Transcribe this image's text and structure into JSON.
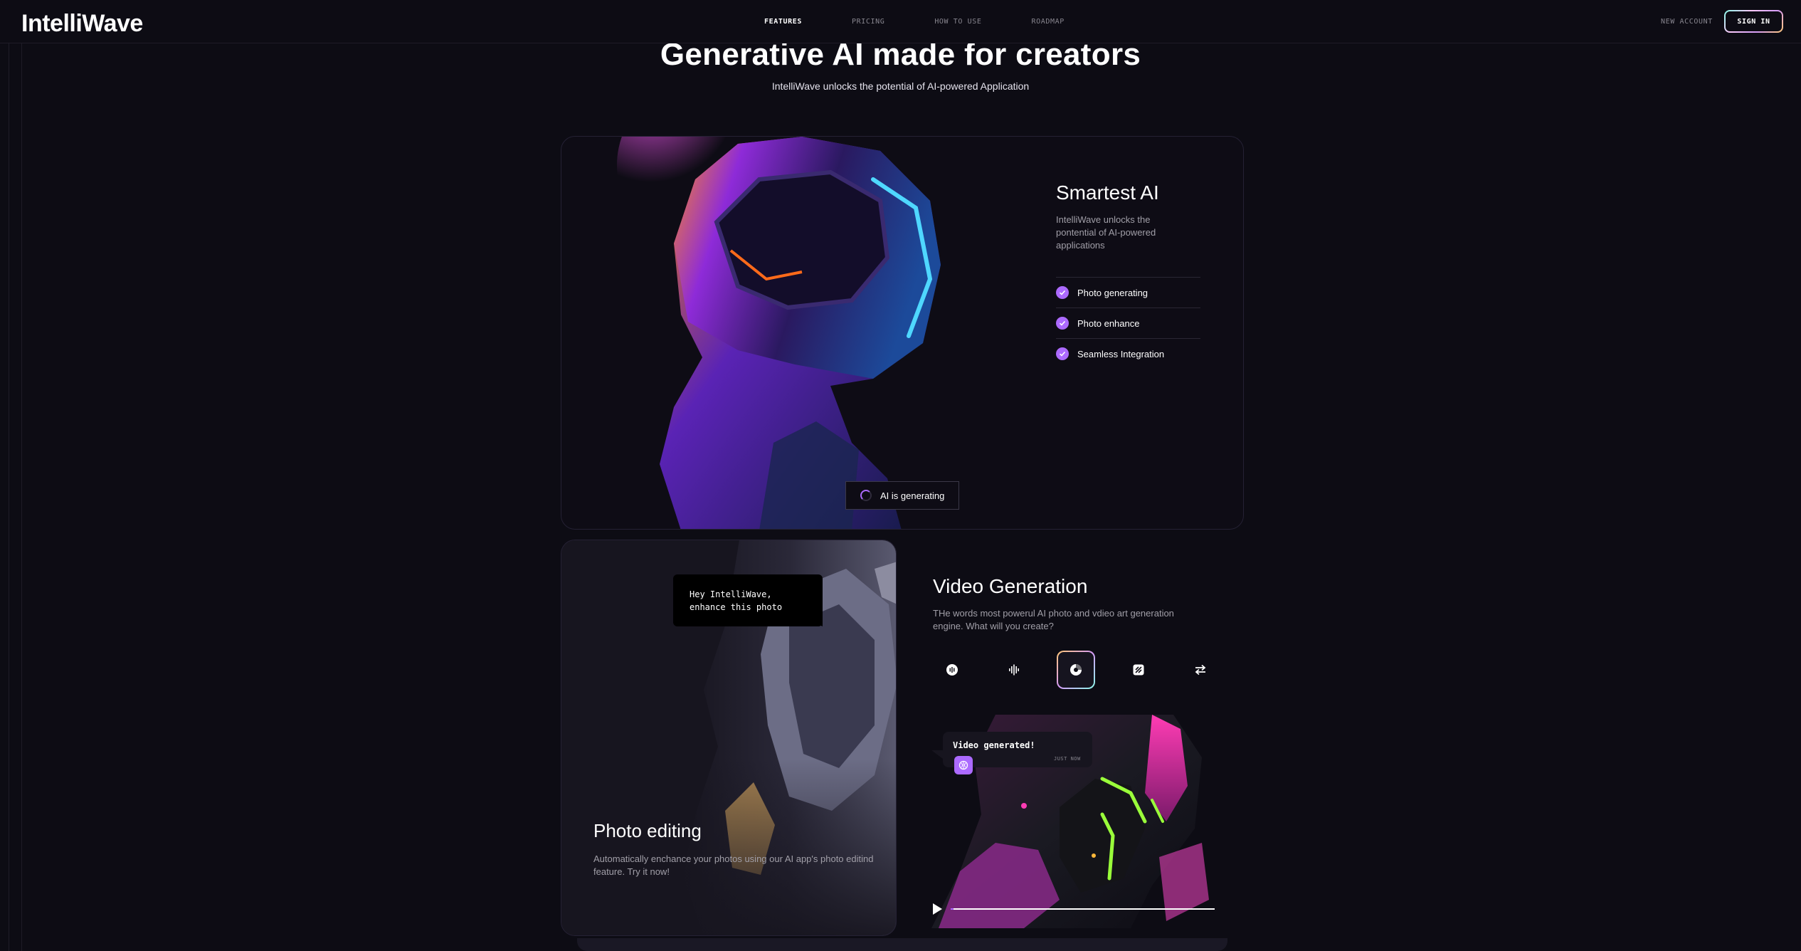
{
  "header": {
    "logo": "IntelliWave",
    "nav": [
      {
        "label": "FEATURES",
        "active": true
      },
      {
        "label": "PRICING",
        "active": false
      },
      {
        "label": "HOW TO USE",
        "active": false
      },
      {
        "label": "ROADMAP",
        "active": false
      }
    ],
    "new_account": "NEW ACCOUNT",
    "sign_in": "SIGN IN"
  },
  "hero": {
    "title": "Generative AI made for creators",
    "subtitle": "IntelliWave unlocks the potential of AI-powered Application"
  },
  "smartest": {
    "title": "Smartest AI",
    "description": "IntelliWave unlocks the pontential of AI-powered applications",
    "features": [
      "Photo generating",
      "Photo enhance",
      "Seamless Integration"
    ],
    "status": "AI is generating"
  },
  "photo_editing": {
    "prompt": "Hey IntelliWave, enhance this photo",
    "title": "Photo editing",
    "description": "Automatically enchance your photos using our AI app's photo editind feature. Try it now!"
  },
  "video": {
    "title": "Video Generation",
    "description": "THe words most powerul AI photo and vdieo art generation engine. What will you create?",
    "tools": [
      "recording-icon",
      "waveform-icon",
      "disc-icon",
      "media-icon",
      "swap-icon"
    ],
    "active_tool": 2,
    "message": "Video generated!",
    "message_time": "JUST NOW",
    "progress": 0.01
  },
  "colors": {
    "accent": "#ac6aff",
    "background": "#0d0c14",
    "border": "#252134"
  }
}
